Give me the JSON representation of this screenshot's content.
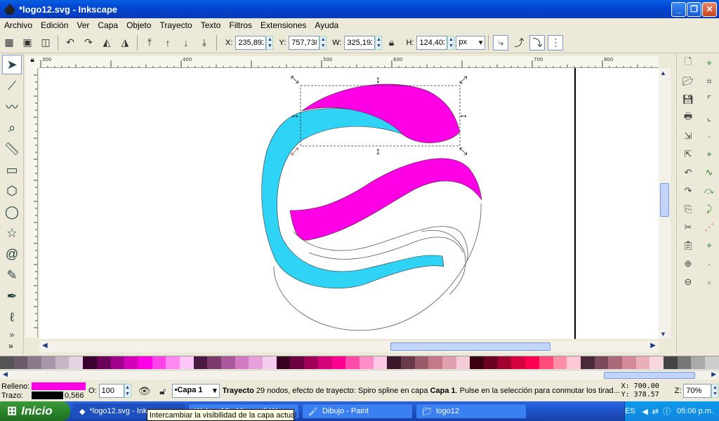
{
  "window": {
    "title": "*logo12.svg - Inkscape"
  },
  "menu": [
    "Archivo",
    "Edición",
    "Ver",
    "Capa",
    "Objeto",
    "Trayecto",
    "Texto",
    "Filtros",
    "Extensiones",
    "Ayuda"
  ],
  "select_toolbar": {
    "x_label": "X:",
    "x_value": "235,892",
    "y_label": "Y:",
    "y_value": "757,738",
    "w_label": "W:",
    "w_value": "325,192",
    "h_label": "H:",
    "h_value": "124,403",
    "unit": "px"
  },
  "ruler": {
    "h_ticks": [
      "300",
      "400",
      "500",
      "600",
      "700",
      "800",
      "900"
    ],
    "v_ticks": [
      "300",
      "400",
      "500",
      "600",
      "700",
      "800",
      "900"
    ]
  },
  "status": {
    "fill_label": "Relleno:",
    "stroke_label": "Trazo:",
    "stroke_width": "0,566",
    "opacity_label": "O:",
    "opacity_value": "100",
    "layer": "•Capa 1",
    "message_bold": "Trayecto",
    "message": " 29 nodos, efecto de trayecto: Spiro spline en capa ",
    "message_layer": "Capa 1",
    "message_tail": ". Pulse en la selección para conmutar los tirad...",
    "x_coord": "X: 700.00",
    "y_coord": "Y: 378.57",
    "zoom_label": "Z:",
    "zoom_value": "70%"
  },
  "taskbar": {
    "start": "Inicio",
    "tasks": [
      "*logo12.svg - Ink...",
      "logo12 - Microsoft W...",
      "Dibujo - Paint",
      "logo12"
    ],
    "lang": "ES",
    "clock": "05:06 p.m."
  },
  "tooltip": "Intercambiar la visibilidad de la capa actual",
  "colors": {
    "fill": "#ff00e6",
    "cyan": "#2fd3f5",
    "magenta": "#ff00e6",
    "accent": "#0a5fe0"
  }
}
